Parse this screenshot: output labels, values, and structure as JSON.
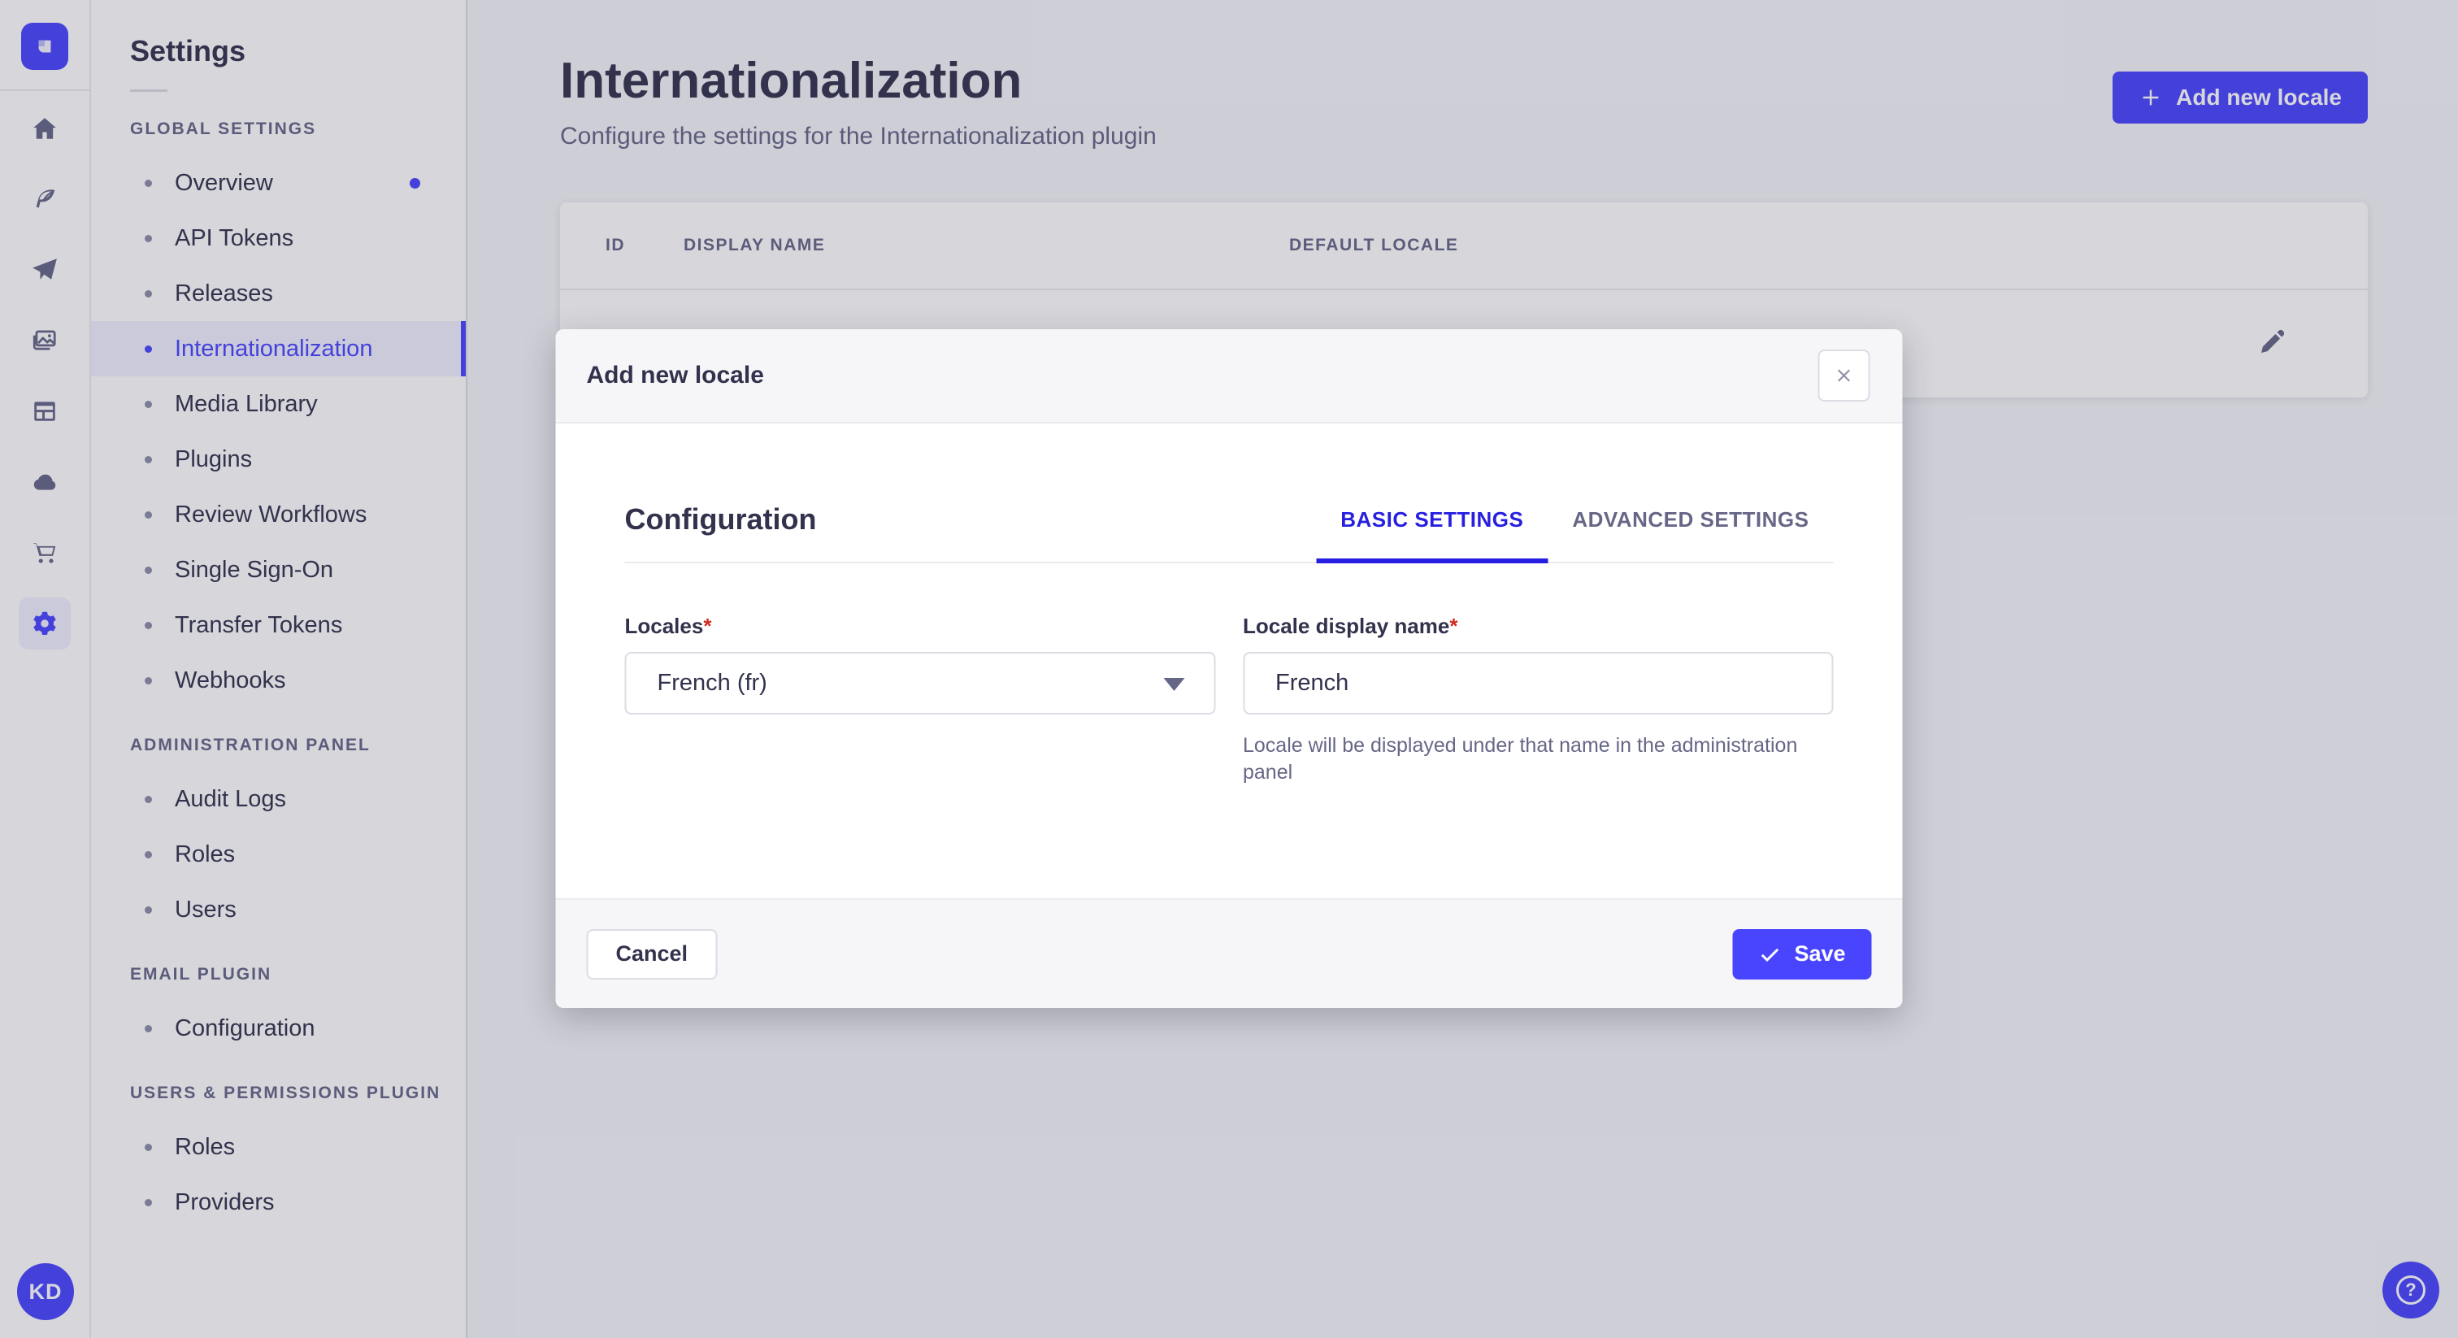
{
  "ui": {
    "required_mark": "*"
  },
  "colors": {
    "accent": "#4945ff",
    "tab_active": "#271fe0",
    "required": "#d02b20",
    "text": "#32324d",
    "muted": "#666687"
  },
  "rail": {
    "icons": [
      "strapi-logo",
      "home-icon",
      "quill-icon",
      "paper-plane-icon",
      "media-images-icon",
      "content-layout-icon",
      "cloud-icon",
      "cart-icon",
      "gear-icon"
    ],
    "active_icon": "gear-icon",
    "avatar_initials": "KD"
  },
  "sidebar": {
    "title": "Settings",
    "sections": [
      {
        "label": "GLOBAL SETTINGS",
        "items": [
          {
            "label": "Overview",
            "notification": true
          },
          {
            "label": "API Tokens"
          },
          {
            "label": "Releases"
          },
          {
            "label": "Internationalization",
            "active": true
          },
          {
            "label": "Media Library"
          },
          {
            "label": "Plugins"
          },
          {
            "label": "Review Workflows"
          },
          {
            "label": "Single Sign-On"
          },
          {
            "label": "Transfer Tokens"
          },
          {
            "label": "Webhooks"
          }
        ]
      },
      {
        "label": "ADMINISTRATION PANEL",
        "items": [
          {
            "label": "Audit Logs"
          },
          {
            "label": "Roles"
          },
          {
            "label": "Users"
          }
        ]
      },
      {
        "label": "EMAIL PLUGIN",
        "items": [
          {
            "label": "Configuration"
          }
        ]
      },
      {
        "label": "USERS & PERMISSIONS PLUGIN",
        "items": [
          {
            "label": "Roles"
          },
          {
            "label": "Providers"
          }
        ]
      }
    ]
  },
  "header": {
    "title": "Internationalization",
    "subtitle": "Configure the settings for the Internationalization plugin",
    "add_button_label": "Add new locale"
  },
  "table": {
    "columns": [
      "ID",
      "DISPLAY NAME",
      "DEFAULT LOCALE"
    ],
    "row_action": "edit"
  },
  "modal": {
    "title": "Add new locale",
    "section_title": "Configuration",
    "tabs": [
      {
        "label": "BASIC SETTINGS",
        "active": true
      },
      {
        "label": "ADVANCED SETTINGS",
        "active": false
      }
    ],
    "fields": {
      "locales": {
        "label": "Locales",
        "required": true,
        "value": "French (fr)"
      },
      "display_name": {
        "label": "Locale display name",
        "required": true,
        "value": "French",
        "hint": "Locale will be displayed under that name in the administration panel"
      }
    },
    "cancel_label": "Cancel",
    "save_label": "Save"
  }
}
